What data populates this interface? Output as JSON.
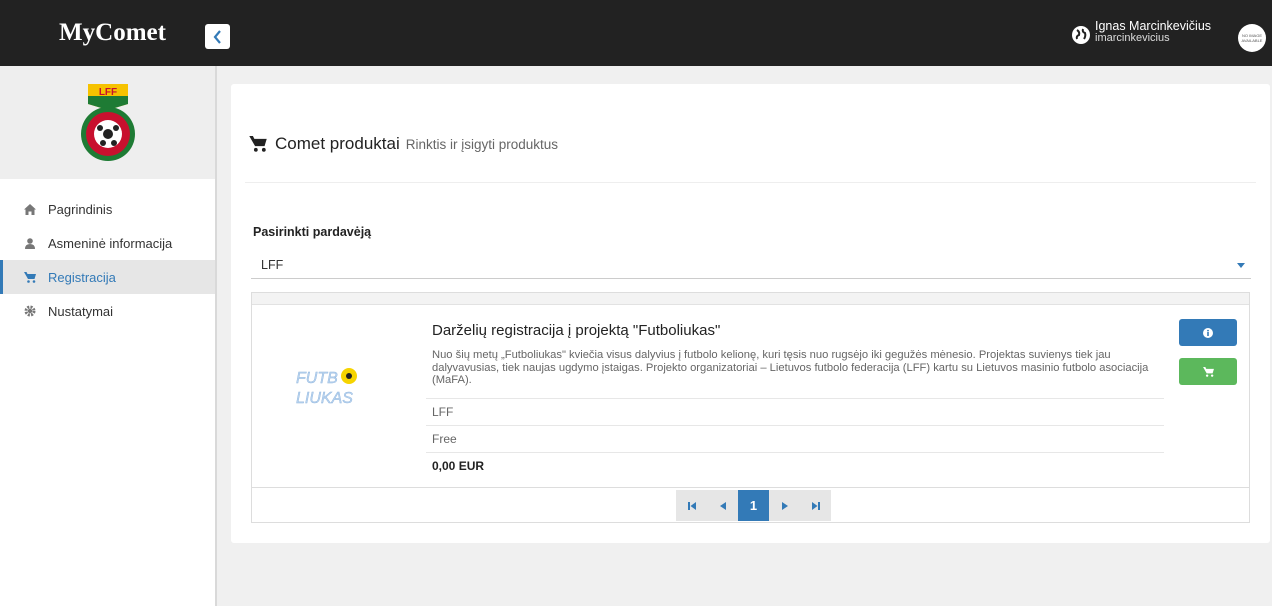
{
  "app": {
    "brand": "MyComet"
  },
  "user": {
    "name": "Ignas Marcinkevičius",
    "username": "imarcinkevicius",
    "avatar_text": "NO IMAGE AVAILABLE"
  },
  "logo": {
    "text": "LFF"
  },
  "sidebar": {
    "items": [
      {
        "label": "Pagrindinis",
        "icon": "home-icon",
        "active": false
      },
      {
        "label": "Asmeninė informacija",
        "icon": "user-icon",
        "active": false
      },
      {
        "label": "Registracija",
        "icon": "cart-icon",
        "active": true
      },
      {
        "label": "Nustatymai",
        "icon": "gear-icon",
        "active": false
      }
    ]
  },
  "page": {
    "title": "Comet produktai",
    "subtitle": "Rinktis ir įsigyti produktus"
  },
  "vendor": {
    "label": "Pasirinkti pardavėją",
    "selected": "LFF"
  },
  "product": {
    "title": "Darželių registracija į projektą \"Futboliukas\"",
    "description": "Nuo šių metų „Futboliukas\" kviečia visus dalyvius į futbolo kelionę, kuri tęsis nuo rugsėjo iki gegužės mėnesio. Projektas suvienys tiek jau dalyvavusias, tiek naujas ugdymo įstaigas. Projekto organizatoriai – Lietuvos futbolo federacija (LFF) kartu su Lietuvos masinio futbolo asociacija (MaFA).",
    "vendor": "LFF",
    "type": "Free",
    "price": "0,00 EUR",
    "logo_line1": "FUTB",
    "logo_line2": "LIUKAS"
  },
  "pager": {
    "current": "1"
  },
  "colors": {
    "primary": "#337ab7",
    "success": "#5cb85c",
    "topbar": "#222222"
  }
}
